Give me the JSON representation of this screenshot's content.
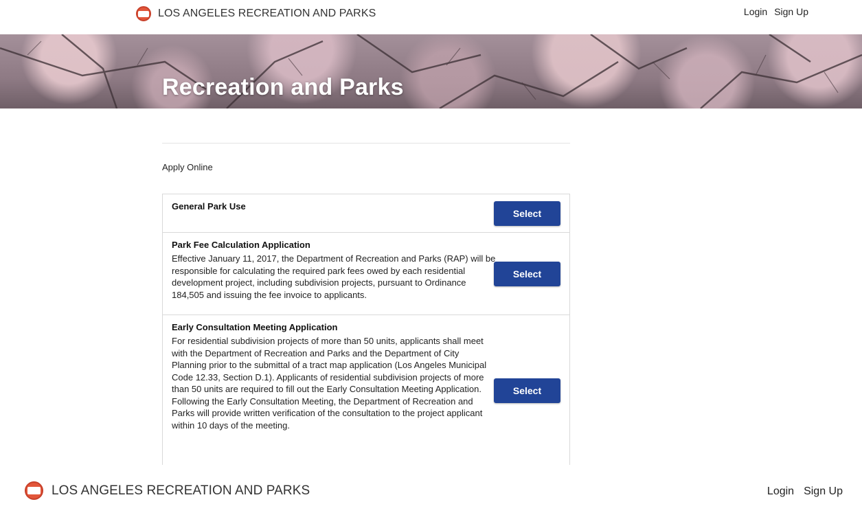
{
  "header": {
    "brand_name": "LOS ANGELES RECREATION AND PARKS",
    "login_label": "Login",
    "signup_label": "Sign Up"
  },
  "hero": {
    "title": "Recreation and Parks"
  },
  "main": {
    "apply_label": "Apply Online",
    "items": [
      {
        "title": "General Park Use",
        "description": "",
        "button_label": "Select"
      },
      {
        "title": "Park Fee Calculation Application",
        "description": "Effective January 11, 2017, the Department of Recreation and Parks (RAP) will be responsible for calculating the required park fees owed by each residential development project, including subdivision projects, pursuant to Ordinance 184,505 and issuing the fee invoice to applicants.",
        "button_label": "Select"
      },
      {
        "title": "Early Consultation Meeting Application",
        "description": "For residential subdivision projects of more than 50 units, applicants shall meet with the Department of Recreation and Parks and the Department of City Planning prior to the submittal of a tract map application (Los Angeles Municipal Code 12.33, Section D.1). Applicants of residential subdivision projects of more than 50 units are required to fill out the Early Consultation Meeting Application. Following the Early Consultation Meeting, the Department of Recreation and Parks will provide written verification of the consultation to the project applicant within 10 days of the meeting.",
        "button_label": "Select"
      }
    ]
  },
  "footer": {
    "brand_name": "LOS ANGELES RECREATION AND PARKS",
    "login_label": "Login",
    "signup_label": "Sign Up"
  },
  "colors": {
    "button_bg": "#214497",
    "logo_red": "#e2563a",
    "hero_title": "#ffffff"
  }
}
